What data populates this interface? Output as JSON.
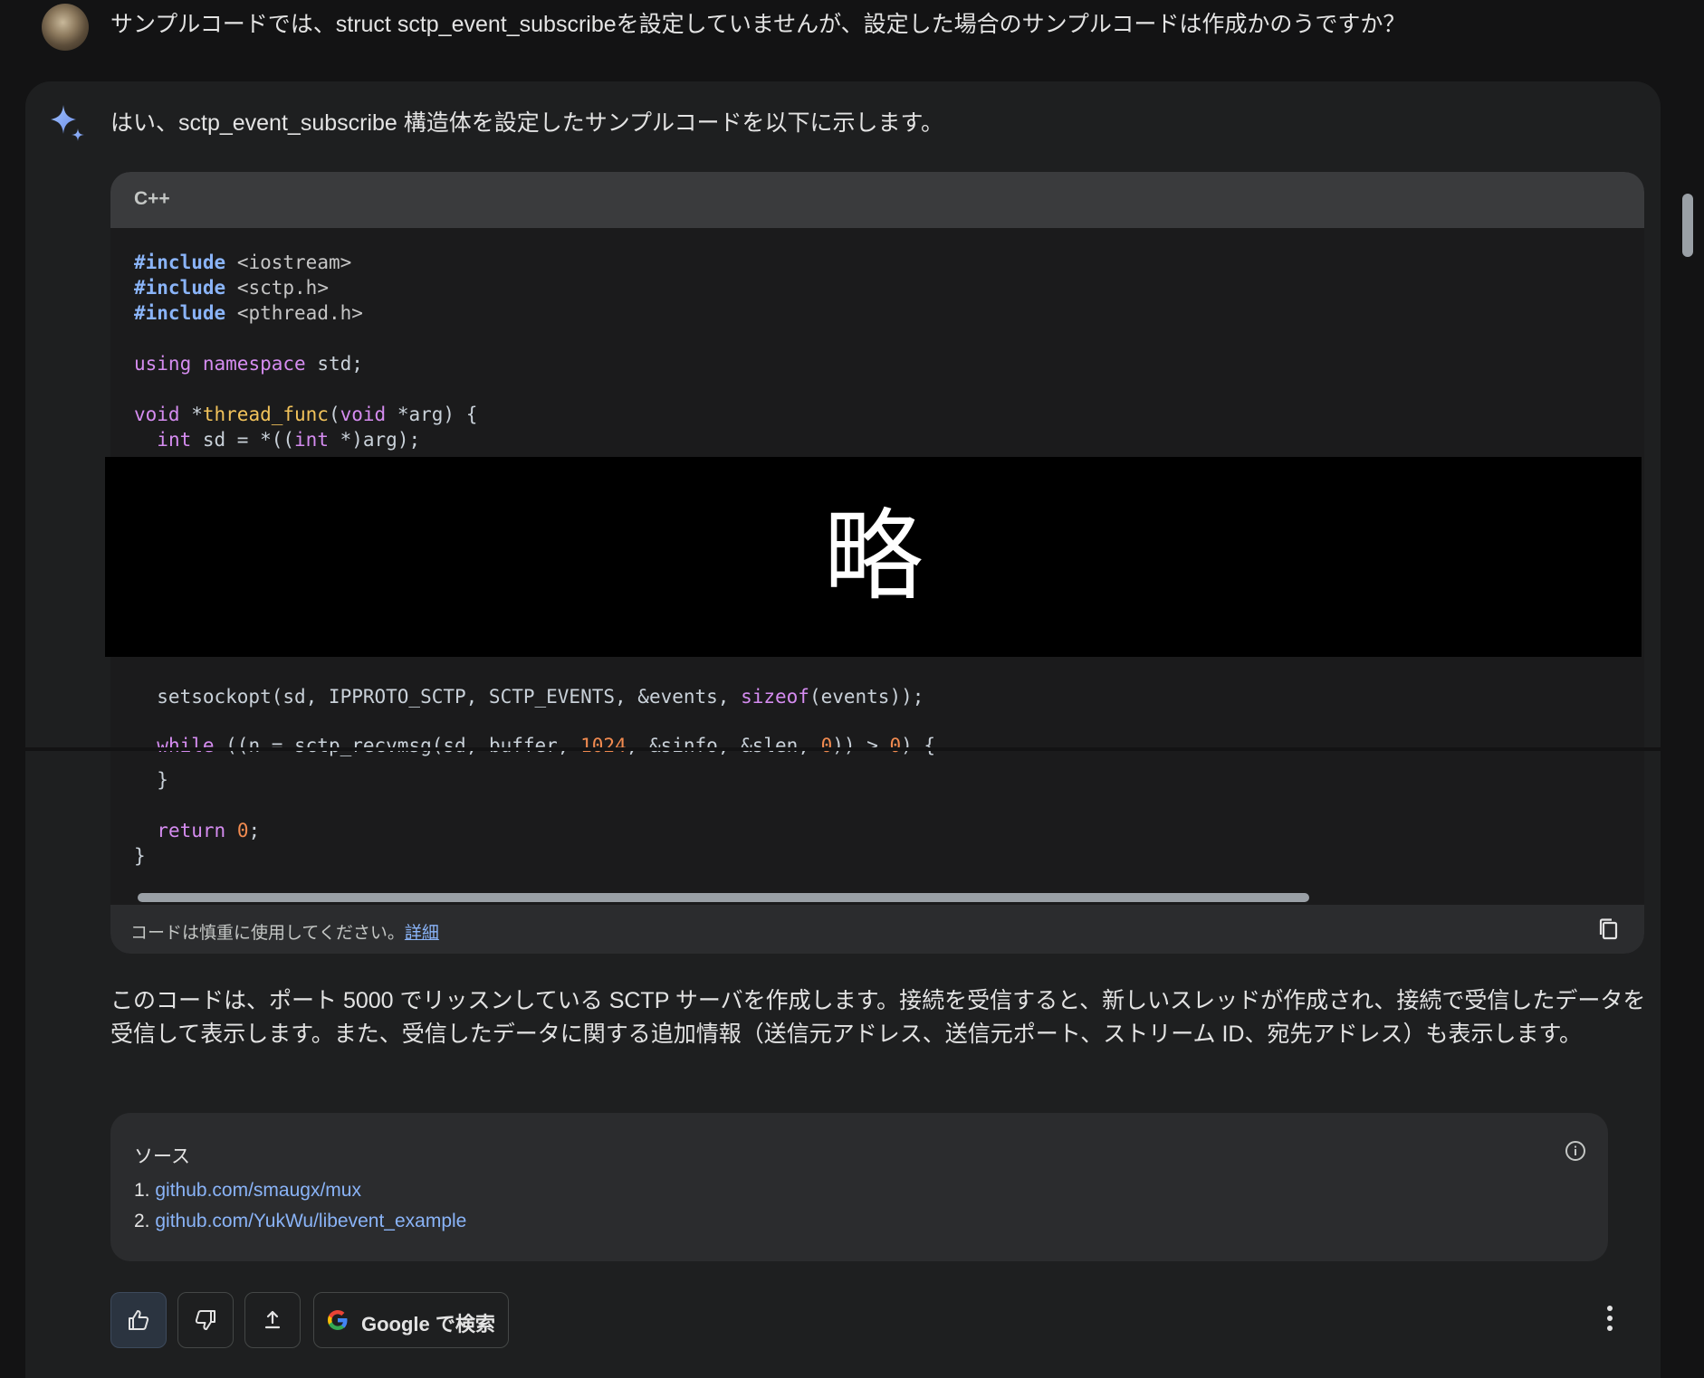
{
  "user_prompt": {
    "text": "サンプルコードでは、struct sctp_event_subscribeを設定していませんが、設定した場合のサンプルコードは作成かのうですか？"
  },
  "response": {
    "intro": "はい、sctp_event_subscribe 構造体を設定したサンプルコードを以下に示します。",
    "code": {
      "language": "C++",
      "lines_top": [
        "#include <iostream>",
        "#include <sctp.h>",
        "#include <pthread.h>",
        "",
        "using namespace std;",
        "",
        "void *thread_func(void *arg) {",
        "  int sd = *((int *)arg);"
      ],
      "redaction_label": "略",
      "lines_bottom": [
        "  setsockopt(sd, IPPROTO_SCTP, SCTP_EVENTS, &events, sizeof(events));",
        "",
        "  while ((n = sctp_recvmsg(sd, buffer, 1024, &sinfo, &slen, 0)) > 0) {",
        "  }",
        "",
        "  return 0;",
        "}"
      ],
      "disclaimer": "コードは慎重に使用してください。",
      "disclaimer_link": "詳細"
    },
    "explanation": "このコードは、ポート 5000 でリッスンしている SCTP サーバを作成します。接続を受信すると、新しいスレッドが作成され、接続で受信したデータを受信して表示します。また、受信したデータに関する追加情報（送信元アドレス、送信元ポート、ストリーム ID、宛先アドレス）も表示します。",
    "sources": {
      "title": "ソース",
      "items": [
        {
          "num": "1.",
          "label": "github.com/smaugx/mux"
        },
        {
          "num": "2.",
          "label": "github.com/YukWu/libevent_example"
        }
      ]
    },
    "actions": {
      "google_label": "Google で検索"
    }
  },
  "icons": [
    "sparkle-icon",
    "copy-icon",
    "info-icon",
    "thumb-up-icon",
    "thumb-down-icon",
    "share-icon",
    "google-g-icon",
    "more-vert-icon"
  ],
  "colors": {
    "background": "#131314",
    "card": "#1e1f20",
    "link": "#8ab4f8",
    "keyword": "#d58cf0",
    "function": "#f2c35b",
    "number": "#f28b50"
  }
}
